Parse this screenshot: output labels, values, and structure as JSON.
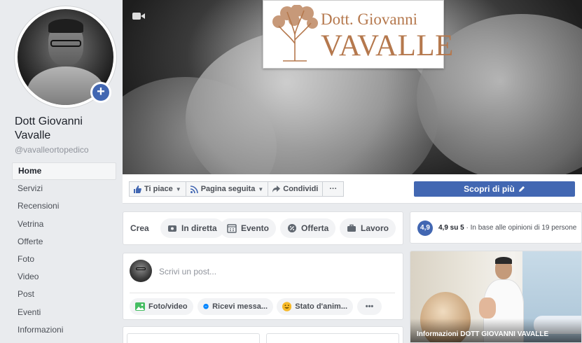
{
  "page": {
    "name": "Dott Giovanni Vavalle",
    "handle": "@vavalleortopedico"
  },
  "sidebar": {
    "items": [
      {
        "label": "Home",
        "active": true
      },
      {
        "label": "Servizi"
      },
      {
        "label": "Recensioni"
      },
      {
        "label": "Vetrina"
      },
      {
        "label": "Offerte"
      },
      {
        "label": "Foto"
      },
      {
        "label": "Video"
      },
      {
        "label": "Post"
      },
      {
        "label": "Eventi"
      },
      {
        "label": "Informazioni"
      }
    ]
  },
  "cover": {
    "logo_line1": "Dott. Giovanni",
    "logo_line2": "VAVALLE"
  },
  "actions": {
    "like": "Ti piace",
    "follow": "Pagina seguita",
    "share": "Condividi",
    "more": "···",
    "primary": "Scopri di più"
  },
  "create": {
    "label": "Crea",
    "items": [
      {
        "label": "In diretta",
        "icon": "live-video-icon"
      },
      {
        "label": "Evento",
        "icon": "calendar-icon"
      },
      {
        "label": "Offerta",
        "icon": "offer-tag-icon"
      },
      {
        "label": "Lavoro",
        "icon": "briefcase-icon"
      }
    ]
  },
  "rating": {
    "badge": "4,9",
    "score": "4,9 su 5",
    "detail": " · In base alle opinioni di 19 persone"
  },
  "composer": {
    "placeholder": "Scrivi un post...",
    "photo": "Foto/video",
    "messages": "Ricevi messa...",
    "mood": "Stato d'anim...",
    "more": "•••"
  },
  "video": {
    "title": "Informazioni DOTT GIOVANNI VAVALLE"
  },
  "colors": {
    "brand_blue": "#4267b2",
    "logo_brown": "#b5784d",
    "background": "#e9ebee"
  }
}
